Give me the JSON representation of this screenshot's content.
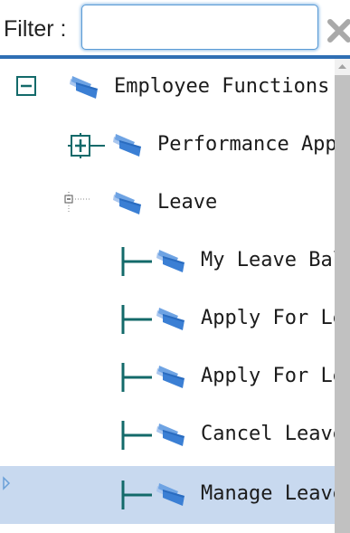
{
  "filter": {
    "label": "Filter :",
    "value": "",
    "clear_icon": "clear-x-icon"
  },
  "tree": {
    "nodes": [
      {
        "label": "Employee Functions",
        "level": 0,
        "toggle": "collapse-minus-icon",
        "icon": "pages-book-icon"
      },
      {
        "label": "Performance Appraisal",
        "level": 1,
        "toggle": "expand-plus-icon",
        "icon": "pages-book-icon"
      },
      {
        "label": "Leave",
        "level": 1,
        "toggle": "collapse-small-icon",
        "icon": "pages-book-icon"
      },
      {
        "label": "My Leave Balance",
        "level": 2,
        "toggle": "tree-connector-icon",
        "icon": "pages-book-icon"
      },
      {
        "label": "Apply For Leave",
        "level": 2,
        "toggle": "tree-connector-icon",
        "icon": "pages-book-icon"
      },
      {
        "label": "Apply For Leave",
        "level": 2,
        "toggle": "tree-connector-icon",
        "icon": "pages-book-icon"
      },
      {
        "label": "Cancel Leave",
        "level": 2,
        "toggle": "tree-connector-icon",
        "icon": "pages-book-icon"
      },
      {
        "label": "Manage Leave",
        "level": 2,
        "toggle": "tree-connector-icon",
        "icon": "pages-book-icon",
        "selected": true
      }
    ]
  },
  "colors": {
    "accent": "#2f6fb4",
    "selection": "#c8d9ef",
    "connector": "#136a6a"
  }
}
